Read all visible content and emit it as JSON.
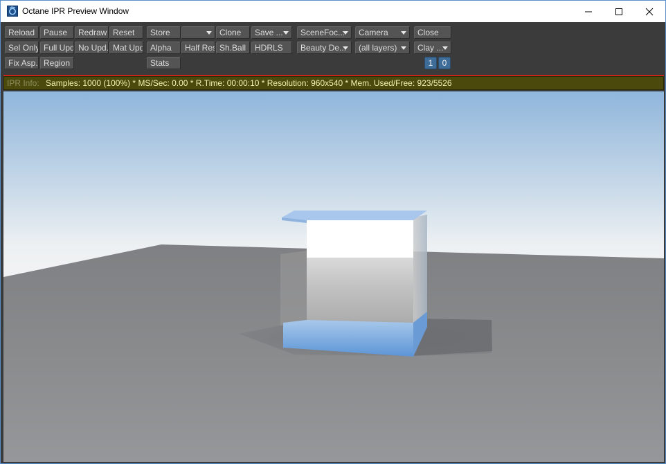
{
  "window": {
    "title": "Octane IPR Preview Window"
  },
  "toolbar": {
    "row1": {
      "reload": "Reload",
      "pause": "Pause",
      "redraw": "Redraw",
      "reset": "Reset",
      "store": "Store",
      "store_select": "",
      "clone": "Clone",
      "save": "Save ...",
      "scene_focus": "SceneFoc...",
      "camera": "Camera",
      "close": "Close"
    },
    "row2": {
      "sel_only": "Sel Only",
      "full_upd": "Full Upd.",
      "no_upd": "No Upd.",
      "mat_upd": "Mat Upd",
      "alpha": "Alpha",
      "half_res": "Half Res",
      "sh_ball": "Sh.Ball",
      "hdrls": "HDRLS",
      "beauty": "Beauty De...",
      "layers": "(all layers)",
      "clay": "Clay ..."
    },
    "row3": {
      "fix_asp": "Fix Asp.",
      "region": "Region",
      "stats": "Stats",
      "num1": "1",
      "num0": "0"
    }
  },
  "info": {
    "label": "IPR Info:",
    "text": "Samples: 1000 (100%)  *  MS/Sec: 0.00  *  R.Time: 00:00:10  *  Resolution: 960x540  *  Mem. Used/Free: 923/5526"
  },
  "icons": {
    "app": "octane-app-icon",
    "minimize": "minimize-icon",
    "maximize": "maximize-icon",
    "close": "close-icon",
    "dropdown": "chevron-down-icon"
  },
  "colors": {
    "toolbar_bg": "#3b3b3b",
    "button_bg": "#545454",
    "info_bg": "#4b4a0c",
    "info_text": "#f2f2b0",
    "status_line": "#c8261b",
    "number_button": "#3f6d9a"
  }
}
